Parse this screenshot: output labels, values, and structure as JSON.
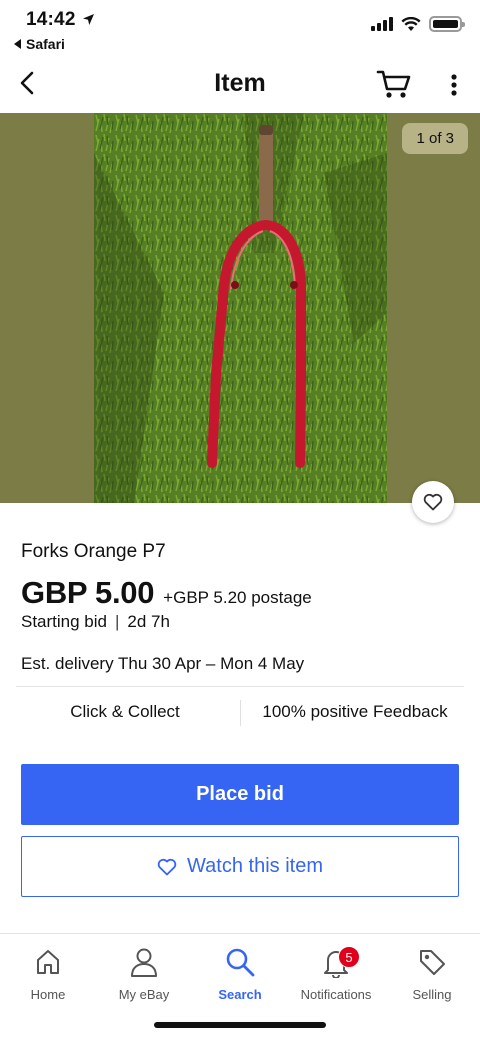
{
  "status_bar": {
    "time": "14:42",
    "back_app": "Safari"
  },
  "header": {
    "title": "Item"
  },
  "gallery": {
    "counter": "1 of 3"
  },
  "item": {
    "title": "Forks Orange P7",
    "price": "GBP 5.00",
    "postage": "+GBP 5.20 postage",
    "bid_type": "Starting bid",
    "time_left": "2d 7h",
    "delivery_label": "Est. delivery",
    "delivery_dates": "Thu 30 Apr – Mon 4 May"
  },
  "features": {
    "left": "Click & Collect",
    "right": "100% positive Feedback"
  },
  "actions": {
    "place_bid": "Place bid",
    "watch": "Watch this item"
  },
  "tabs": [
    {
      "label": "Home"
    },
    {
      "label": "My eBay"
    },
    {
      "label": "Search"
    },
    {
      "label": "Notifications",
      "badge": "5"
    },
    {
      "label": "Selling"
    }
  ],
  "colors": {
    "accent": "#3665f3",
    "badge": "#e0001b",
    "gallery_bg": "#7c7c46"
  }
}
